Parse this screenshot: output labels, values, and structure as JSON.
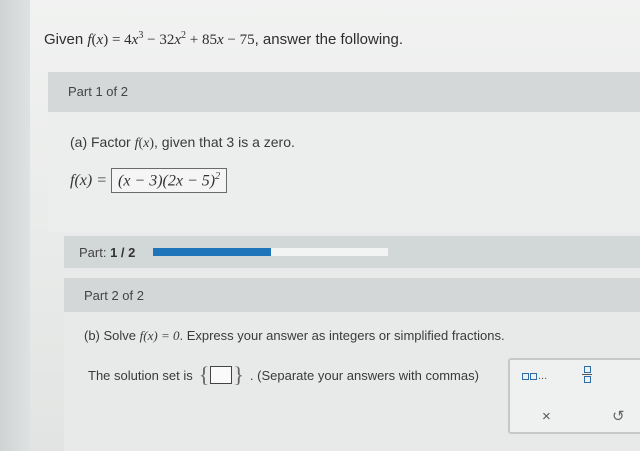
{
  "question": {
    "given": "Given",
    "fname": "f",
    "var": "x",
    "poly_a": "4",
    "exp3": "3",
    "poly_b": "32",
    "exp2": "2",
    "poly_c": "85",
    "poly_d": "75",
    "tail": ", answer the following."
  },
  "part1": {
    "header": "Part 1 of 2",
    "prompt_pre": "(a) Factor",
    "prompt_post": ", given that 3 is a zero.",
    "answer_lhs": "f(x) =",
    "answer_value": "(x − 3)(2x − 5)",
    "answer_exp": "2"
  },
  "progress": {
    "label": "Part:",
    "value": "1 / 2",
    "fraction": 0.5
  },
  "part2": {
    "header": "Part 2 of 2",
    "prompt_pre": "(b) Solve",
    "prompt_eq": "f(x) = 0",
    "prompt_post": ". Express your answer as integers or simplified fractions.",
    "solution_label": "The solution set is",
    "hint": ". (Separate your answers with commas)"
  },
  "keypad": {
    "list_ellipsis": "...",
    "clear_label": "×",
    "undo_label": "↺",
    "list_icon": "list-icon",
    "fraction_icon": "fraction-icon",
    "accent": "#1f75b9"
  }
}
